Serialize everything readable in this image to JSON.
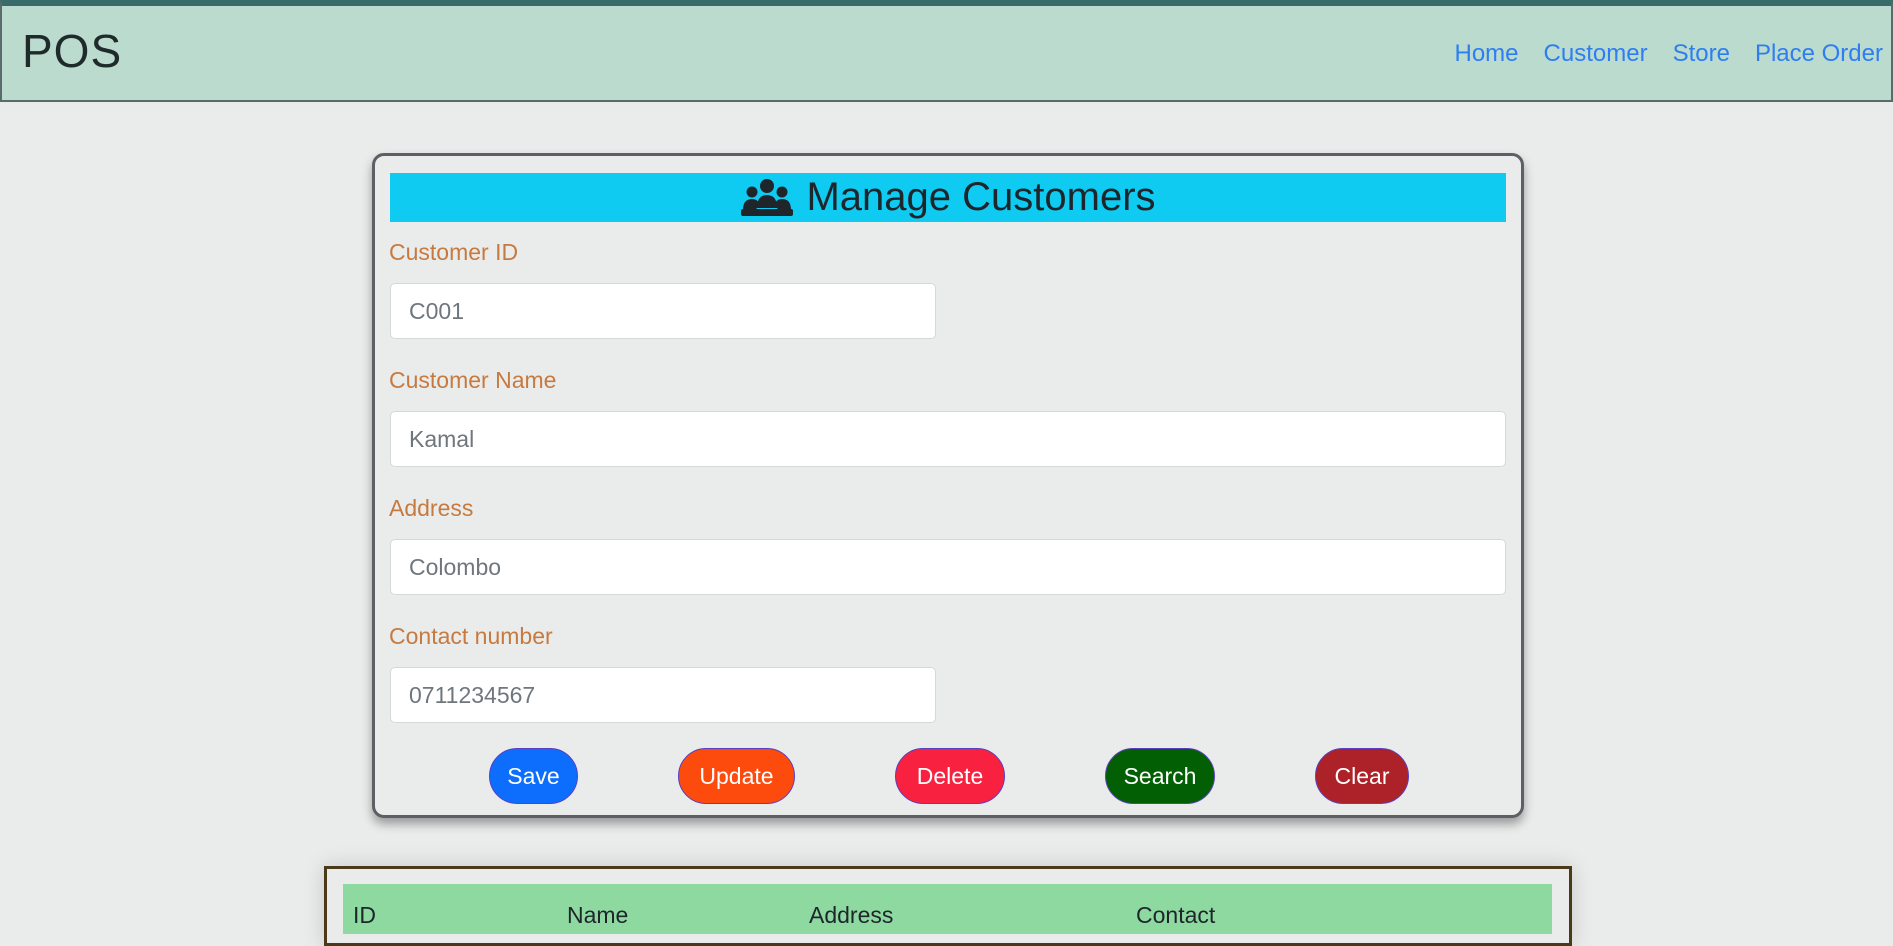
{
  "navbar": {
    "brand": "POS",
    "links": [
      {
        "label": "Home"
      },
      {
        "label": "Customer"
      },
      {
        "label": "Store"
      },
      {
        "label": "Place Order"
      }
    ]
  },
  "form": {
    "title": "Manage Customers",
    "title_icon": "users-icon",
    "fields": {
      "customer_id": {
        "label": "Customer ID",
        "placeholder": "C001"
      },
      "customer_name": {
        "label": "Customer Name",
        "placeholder": "Kamal"
      },
      "address": {
        "label": "Address",
        "placeholder": "Colombo"
      },
      "contact": {
        "label": "Contact number",
        "placeholder": "0711234567"
      }
    },
    "buttons": {
      "save": {
        "label": "Save",
        "color": "#0d6efd"
      },
      "update": {
        "label": "Update",
        "color": "#fd4a0d"
      },
      "delete": {
        "label": "Delete",
        "color": "#f8213f"
      },
      "search": {
        "label": "Search",
        "color": "#035f03"
      },
      "clear": {
        "label": "Clear",
        "color": "#ad2228"
      }
    }
  },
  "table": {
    "headers": [
      "ID",
      "Name",
      "Address",
      "Contact"
    ]
  }
}
